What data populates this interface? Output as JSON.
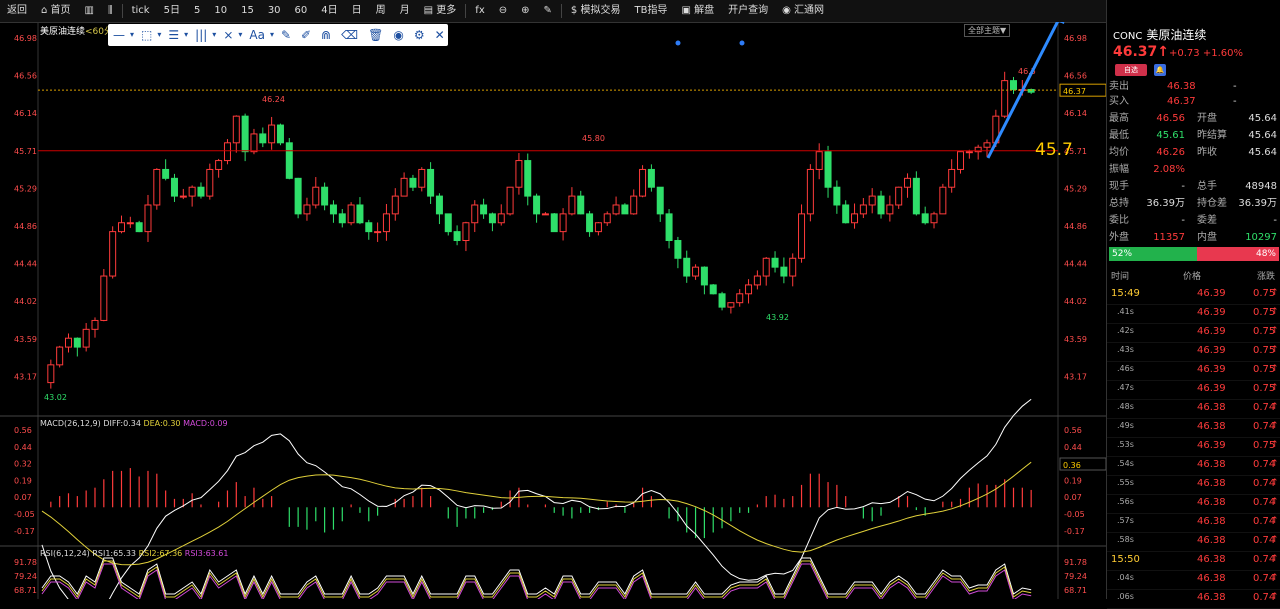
{
  "toolbar": {
    "items": [
      "返回",
      "首页",
      "",
      "",
      "tick",
      "5日",
      "5",
      "10",
      "15",
      "30",
      "60",
      "4日",
      "日",
      "周",
      "月",
      "更多",
      "fx",
      "",
      "",
      "",
      "模拟交易",
      "TB指导",
      "解盘",
      "开户查询",
      "汇通网"
    ]
  },
  "chart": {
    "symbol": "美原油连续",
    "period": "<60分>",
    "theme_button": "全部主题▼",
    "price_labels": [
      "46.98",
      "46.56",
      "46.14",
      "45.71",
      "45.29",
      "44.86",
      "44.44",
      "44.02",
      "43.59",
      "43.17"
    ],
    "current_price_tag": "46.37",
    "annotations": {
      "high1": "46.24",
      "high2": "45.80",
      "low1": "43.92",
      "low0": "43.02",
      "high3": "46.5",
      "level_text": "45.7"
    },
    "macd": {
      "title": "MACD(26,12,9)",
      "diff": "DIFF:0.34",
      "dea": "DEA:0.30",
      "macd": "MACD:0.09",
      "labels": [
        "0.56",
        "0.44",
        "0.32",
        "0.19",
        "0.07",
        "-0.05",
        "-0.17"
      ],
      "tag": "0.36"
    },
    "rsi": {
      "title": "RSI(6,12,24)",
      "rsi1": "RSI1:65.33",
      "rsi2": "RSI2:67.36",
      "rsi3": "RSI3:63.61",
      "labels": [
        "91.78",
        "79.24",
        "68.71"
      ]
    },
    "drawbar_icons": [
      "line-tool-icon",
      "rect-tool-icon",
      "fib-tool-icon",
      "channel-tool-icon",
      "pattern-tool-icon",
      "text-tool-icon",
      "pen-icon",
      "pencil-icon",
      "magnet-icon",
      "eraser-icon",
      "trash-icon",
      "eye-icon",
      "settings-icon",
      "close-icon"
    ],
    "drawbar_text": [
      "—",
      "▾",
      "⬚",
      "▾",
      "☰",
      "▾",
      "|||",
      "▾",
      "⨯",
      "▾",
      "Aa",
      "▾",
      "✎",
      "✐",
      "⋒",
      "⌫",
      "🗑",
      "◉",
      "⚙",
      "✕"
    ]
  },
  "quote": {
    "code": "CONC",
    "name": "美原油连续",
    "price": "46.37",
    "arrow": "↑",
    "change": "+0.73",
    "change_pct": "+1.60%",
    "badge": "自选",
    "sell_label": "卖出",
    "sell_price": "46.38",
    "sell_vol": "-",
    "buy_label": "买入",
    "buy_price": "46.37",
    "buy_vol": "-",
    "stats": [
      {
        "l1": "最高",
        "v1": "46.56",
        "c1": "red",
        "l2": "开盘",
        "v2": "45.64",
        "c2": "wht"
      },
      {
        "l1": "最低",
        "v1": "45.61",
        "c1": "grn",
        "l2": "昨结算",
        "v2": "45.64",
        "c2": "wht"
      },
      {
        "l1": "均价",
        "v1": "46.26",
        "c1": "red",
        "l2": "昨收",
        "v2": "45.64",
        "c2": "wht"
      },
      {
        "l1": "振幅",
        "v1": "2.08%",
        "c1": "red",
        "l2": "",
        "v2": "",
        "c2": "wht"
      },
      {
        "l1": "现手",
        "v1": "-",
        "c1": "wht",
        "l2": "总手",
        "v2": "48948",
        "c2": "wht"
      },
      {
        "l1": "总持",
        "v1": "36.39万",
        "c1": "wht",
        "l2": "持仓差",
        "v2": "36.39万",
        "c2": "wht"
      },
      {
        "l1": "委比",
        "v1": "-",
        "c1": "wht",
        "l2": "委差",
        "v2": "-",
        "c2": "wht"
      },
      {
        "l1": "外盘",
        "v1": "11357",
        "c1": "red",
        "l2": "内盘",
        "v2": "10297",
        "c2": "grn"
      }
    ],
    "ratio_green": "52%",
    "ratio_red": "48%",
    "ticks_header": {
      "time": "时间",
      "price": "价格",
      "change": "涨跌"
    },
    "ticks": [
      {
        "t": "15:49",
        "p": "46.39",
        "c": "0.75",
        "hl": true
      },
      {
        "t": ".41s",
        "p": "46.39",
        "c": "0.75",
        "hl": false
      },
      {
        "t": ".42s",
        "p": "46.39",
        "c": "0.75",
        "hl": false
      },
      {
        "t": ".43s",
        "p": "46.39",
        "c": "0.75",
        "hl": false
      },
      {
        "t": ".46s",
        "p": "46.39",
        "c": "0.75",
        "hl": false
      },
      {
        "t": ".47s",
        "p": "46.39",
        "c": "0.75",
        "hl": false
      },
      {
        "t": ".48s",
        "p": "46.38",
        "c": "0.74",
        "hl": false
      },
      {
        "t": ".49s",
        "p": "46.38",
        "c": "0.74",
        "hl": false
      },
      {
        "t": ".53s",
        "p": "46.39",
        "c": "0.75",
        "hl": false
      },
      {
        "t": ".54s",
        "p": "46.38",
        "c": "0.74",
        "hl": false
      },
      {
        "t": ".55s",
        "p": "46.38",
        "c": "0.74",
        "hl": false
      },
      {
        "t": ".56s",
        "p": "46.38",
        "c": "0.74",
        "hl": false
      },
      {
        "t": ".57s",
        "p": "46.38",
        "c": "0.74",
        "hl": false
      },
      {
        "t": ".58s",
        "p": "46.38",
        "c": "0.74",
        "hl": false
      },
      {
        "t": "15:50",
        "p": "46.38",
        "c": "0.74",
        "hl": true
      },
      {
        "t": ".04s",
        "p": "46.38",
        "c": "0.74",
        "hl": false
      },
      {
        "t": ".06s",
        "p": "46.38",
        "c": "0.74",
        "hl": false
      }
    ]
  },
  "colors": {
    "up": "#ff3b3b",
    "down": "#2fdf6a",
    "accent": "#ffcc00",
    "trend": "#2e8bff"
  }
}
